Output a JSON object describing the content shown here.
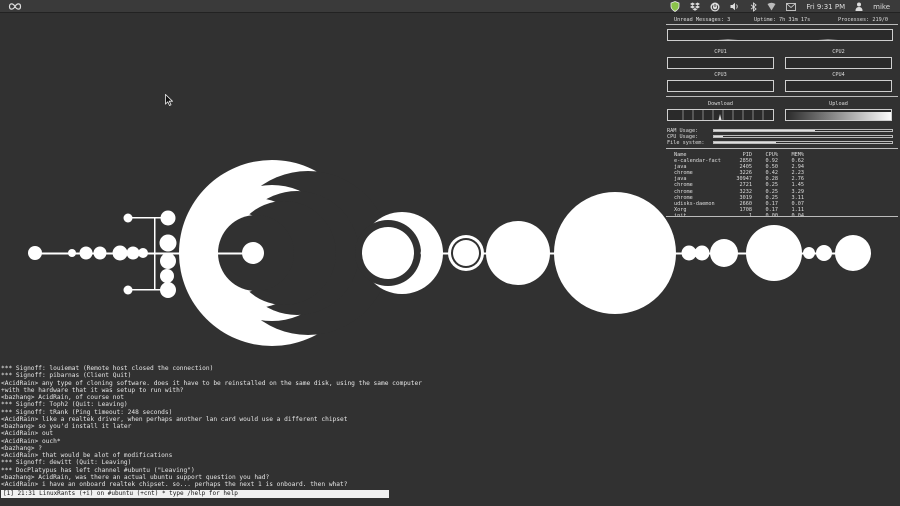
{
  "topbar": {
    "clock": "Fri 9:31 PM",
    "user": "mike",
    "icons": [
      "infinity-icon",
      "shield-icon",
      "dropbox-icon",
      "power-icon",
      "volume-icon",
      "bluetooth-icon",
      "network-icon",
      "mail-icon",
      "user-icon"
    ]
  },
  "conky": {
    "unread": "Unread Messages: 3",
    "uptime": "Uptime: 7h 31m 17s",
    "processes": "Processes: 219/0",
    "cpu_labels": [
      "CPU1",
      "CPU2",
      "CPU3",
      "CPU4"
    ],
    "download": "Download",
    "upload": "Upload",
    "ram_label": "RAM Usage:",
    "cpu_label": "CPU Usage:",
    "fs_label": "File system:",
    "ram_usage": 0.57,
    "cpu_usage": 0.05,
    "fs_usage": 0.35,
    "table_headers": [
      "Name",
      "PID",
      "CPU%",
      "MEM%"
    ],
    "procs": [
      [
        "e-calendar-fact",
        "2850",
        "0.92",
        "0.62"
      ],
      [
        "java",
        "2405",
        "0.50",
        "2.94"
      ],
      [
        "chrome",
        "3226",
        "0.42",
        "2.23"
      ],
      [
        "java",
        "30947",
        "0.28",
        "2.76"
      ],
      [
        "chrome",
        "2721",
        "0.25",
        "1.45"
      ],
      [
        "chrome",
        "3232",
        "0.25",
        "3.29"
      ],
      [
        "chrome",
        "3019",
        "0.25",
        "3.11"
      ],
      [
        "udisks-daemon",
        "2660",
        "0.17",
        "0.07"
      ],
      [
        "Xorg",
        "1708",
        "0.17",
        "1.11"
      ],
      [
        "init",
        "1",
        "0.00",
        "0.04"
      ]
    ]
  },
  "irc": {
    "lines": [
      "*** Signoff: louiemat (Remote host closed the connection)",
      "*** Signoff: pibarnas (Client Quit)",
      "<AcidRain> any type of cloning software. does it have to be reinstalled on the same disk, using the same computer",
      "+with the hardware that it was setup to run with?",
      "<bazhang> AcidRain, of course not",
      "*** Signoff: Toph2 (Quit: Leaving)",
      "*** Signoff: tRank (Ping timeout: 248 seconds)",
      "<AcidRain> like a realtek driver, when perhaps another lan card would use a different chipset",
      "<bazhang> so you'd install it later",
      "<AcidRain> out",
      "<AcidRain> ouch*",
      "<bazhang> ?",
      "<AcidRain> that would be alot of modifications",
      "*** Signoff: dewitt (Quit: Leaving)",
      "*** DocPlatypus has left channel #ubuntu (\"Leaving\")",
      "<bazhang> AcidRain, was there an actual ubuntu support question you had?",
      "<AcidRain> i have an onboard realtek chipset. so... perhaps the next 1 is onboard. then what?"
    ],
    "status": "[1] 21:31 LinuxRants (+i) on #ubuntu (+cnt) * type /help for help"
  }
}
